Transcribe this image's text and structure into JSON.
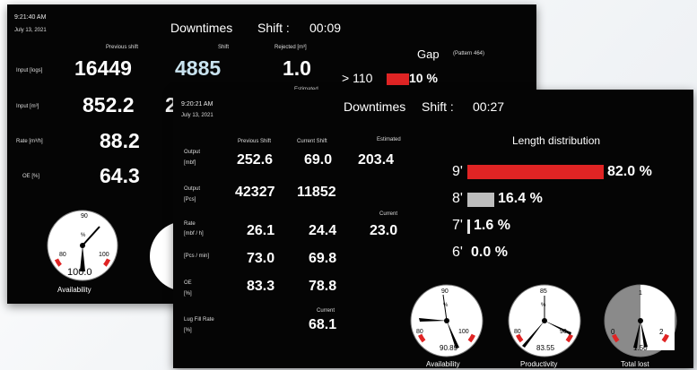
{
  "back_panel": {
    "time": "9:21:40 AM",
    "date": "July 13, 2021",
    "downtimes": "Downtimes",
    "shift_label": "Shift :",
    "shift_time": "00:09",
    "col_previous": "Previous shift",
    "col_shift": "Shift",
    "col_rejected": "Rejected [m³]",
    "estimated": "Estimated",
    "rows": [
      {
        "label": "Input [logs]",
        "prev": "16449",
        "shift": "4885",
        "rejected": "1.0"
      },
      {
        "label": "Input [m³]",
        "prev": "852.2",
        "shift": "2"
      },
      {
        "label": "Rate [m³/h]",
        "prev": "88.2"
      },
      {
        "label": "OE [%]",
        "prev": "64.3"
      }
    ],
    "gap_title": "Gap",
    "gap_pattern": "(Pattern 464)",
    "gap_row_label": "> 110",
    "gap_row_value": "10 %",
    "gap_fill": 0.1,
    "gauge": {
      "label": "Availability",
      "value": "100.0",
      "ticks": [
        "80",
        "90",
        "100"
      ],
      "unit": "%"
    }
  },
  "front_panel": {
    "time": "9:20:21 AM",
    "date": "July 13, 2021",
    "downtimes": "Downtimes",
    "shift_label": "Shift :",
    "shift_time": "00:27",
    "col_previous": "Previous Shift",
    "col_current": "Current Shift",
    "col_estimated": "Estimated",
    "col_current2": "Current",
    "col_current3": "Current",
    "rows": [
      {
        "label1": "Output",
        "label2": "[mbf]",
        "prev": "252.6",
        "cur": "69.0",
        "extra": "203.4"
      },
      {
        "label1": "Output",
        "label2": "[Pcs]",
        "prev": "42327",
        "cur": "11852"
      },
      {
        "label1": "Rate",
        "label2": "[mbf / h]",
        "prev": "26.1",
        "cur": "24.4",
        "extra": "23.0"
      },
      {
        "label1": "[Pcs / min]",
        "label2": "",
        "prev": "73.0",
        "cur": "69.8"
      },
      {
        "label1": "OE",
        "label2": "[%]",
        "prev": "83.3",
        "cur": "78.8"
      },
      {
        "label1": "Lug Fill Rate",
        "label2": "[%]",
        "cur": "68.1"
      }
    ],
    "length_title": "Length distribution",
    "length_rows": [
      {
        "len": "9'",
        "pct_label": "82.0 %",
        "fill": 0.82,
        "color": "#e02424"
      },
      {
        "len": "8'",
        "pct_label": "16.4 %",
        "fill": 0.164,
        "color": "#bdbdbd"
      },
      {
        "len": "7'",
        "pct_label": "1.6 %",
        "fill": 0.016,
        "color": "#e6e6e6"
      },
      {
        "len": "6'",
        "pct_label": "0.0 %",
        "fill": 0.0,
        "color": "#e6e6e6"
      }
    ],
    "gauges": [
      {
        "label": "Availability",
        "value": "90.89",
        "ticks": [
          "80",
          "90",
          "100"
        ],
        "unit": "%",
        "style": "white"
      },
      {
        "label": "Productivity",
        "value": "83.55",
        "ticks": [
          "80",
          "85",
          "90"
        ],
        "unit": "%",
        "style": "white"
      },
      {
        "label": "Total lost",
        "value": "1.50",
        "ticks": [
          "0",
          "1",
          "2"
        ],
        "unit": "",
        "style": "gray"
      }
    ]
  },
  "colors": {
    "panel_bg": "#050505",
    "bar_red": "#e02424",
    "bar_gray": "#bdbdbd",
    "rate_value": "#c9e3ef"
  }
}
